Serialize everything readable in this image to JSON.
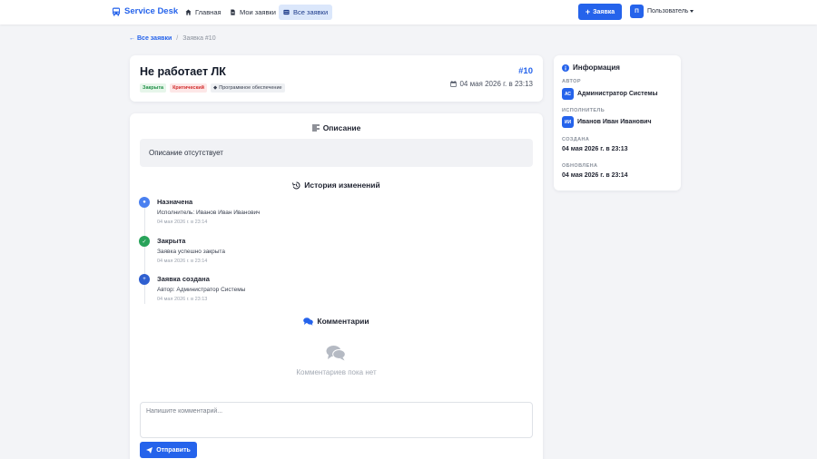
{
  "navbar": {
    "brand": "Service Desk",
    "links": [
      {
        "label": "Главная",
        "icon": "home-icon"
      },
      {
        "label": "Мои заявки",
        "icon": "file-icon"
      },
      {
        "label": "Все заявки",
        "icon": "list-icon",
        "active": true
      }
    ],
    "new_button": "Заявка",
    "user_initial": "П",
    "user_name": "Пользователь"
  },
  "breadcrumb": {
    "back": "Все заявки",
    "separator": "/",
    "current": "Заявка #10"
  },
  "ticket": {
    "title": "Не работает ЛК",
    "number": "#10",
    "badges": {
      "status": "Закрыта",
      "priority": "Критический",
      "category": "Программное обеспечение"
    },
    "date": "04 мая 2026 г. в 23:13"
  },
  "description": {
    "heading": "Описание",
    "text": "Описание отсутствует"
  },
  "history": {
    "heading": "История изменений",
    "items": [
      {
        "title": "Назначена",
        "text": "Исполнитель: Иванов Иван Иванович",
        "time": "04 мая 2026 г. в 23:14",
        "color": "#4a80f0"
      },
      {
        "title": "Закрыта",
        "text": "Заявка успешно закрыта",
        "time": "04 мая 2026 г. в 23:14",
        "color": "#28a35a"
      },
      {
        "title": "Заявка создана",
        "text": "Автор: Администратор Системы",
        "time": "04 мая 2026 г. в 23:13",
        "color": "#2f5fd0"
      }
    ]
  },
  "comments": {
    "heading": "Комментарии",
    "empty": "Комментариев пока нет",
    "placeholder": "Напишите комментарий...",
    "send": "Отправить"
  },
  "info": {
    "heading": "Информация",
    "author_label": "АВТОР",
    "author_initials": "АС",
    "author_name": "Администратор Системы",
    "assignee_label": "ИСПОЛНИТЕЛЬ",
    "assignee_initials": "ИИ",
    "assignee_name": "Иванов Иван Иванович",
    "created_label": "СОЗДАНА",
    "created_value": "04 мая 2026 г. в 23:13",
    "updated_label": "ОБНОВЛЕНА",
    "updated_value": "04 мая 2026 г. в 23:14"
  },
  "colors": {
    "accent": "#2563eb",
    "success": "#1f8f46",
    "danger": "#d12b2b"
  }
}
